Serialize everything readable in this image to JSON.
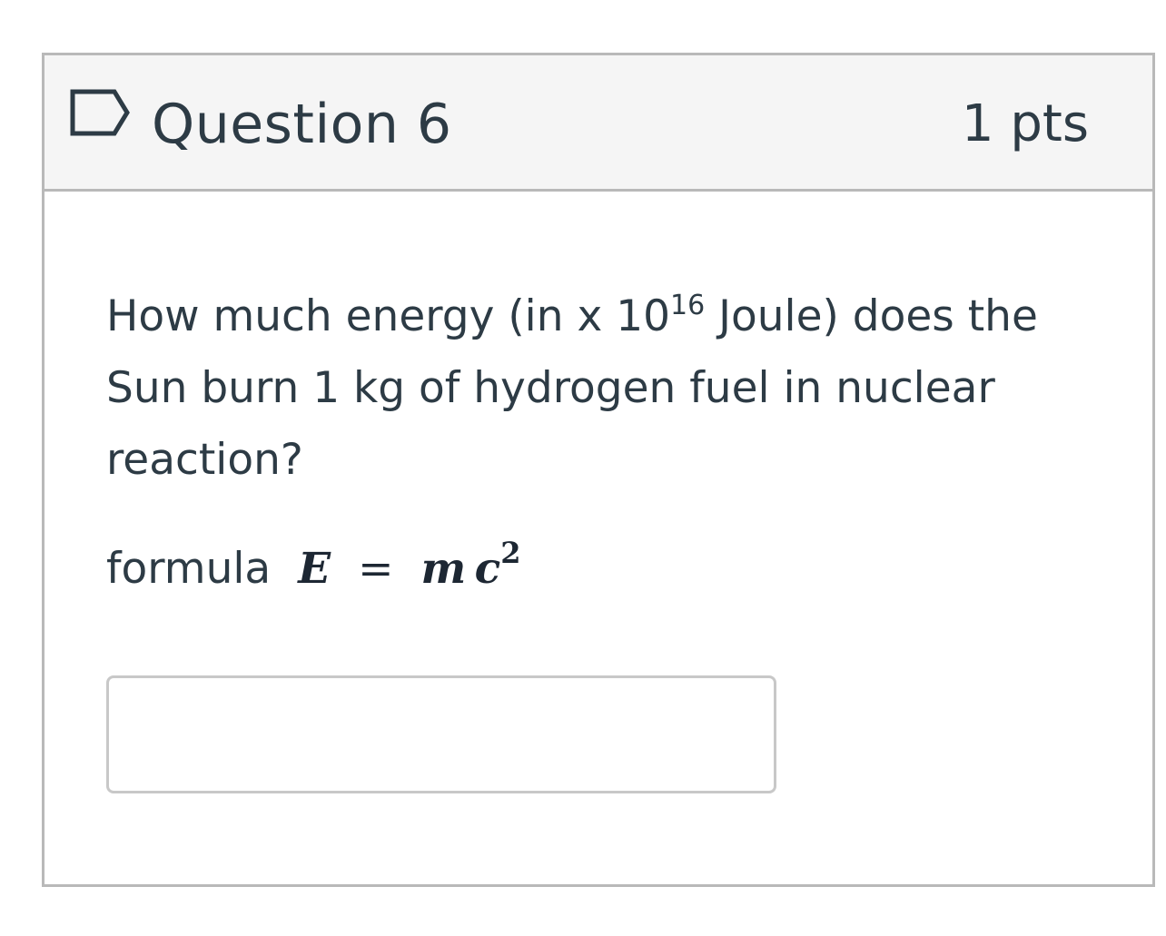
{
  "question": {
    "title": "Question 6",
    "points": "1 pts",
    "flag_icon": "flag-outline-icon",
    "text_before_sup": "How much energy (in x 10",
    "exponent": "16",
    "text_after_sup": " Joule) does the Sun burn 1 kg of hydrogen fuel in nuclear reaction?",
    "formula_label": "formula",
    "formula": {
      "lhs": "E",
      "operator": "=",
      "rhs_m": "m",
      "rhs_c": "c",
      "rhs_exponent": "2"
    },
    "answer": {
      "value": "",
      "placeholder": ""
    }
  },
  "colors": {
    "header_bg": "#f5f5f5",
    "border": "#b9b9b9",
    "text": "#2d3b45",
    "flag_stroke": "#2d3b45"
  }
}
